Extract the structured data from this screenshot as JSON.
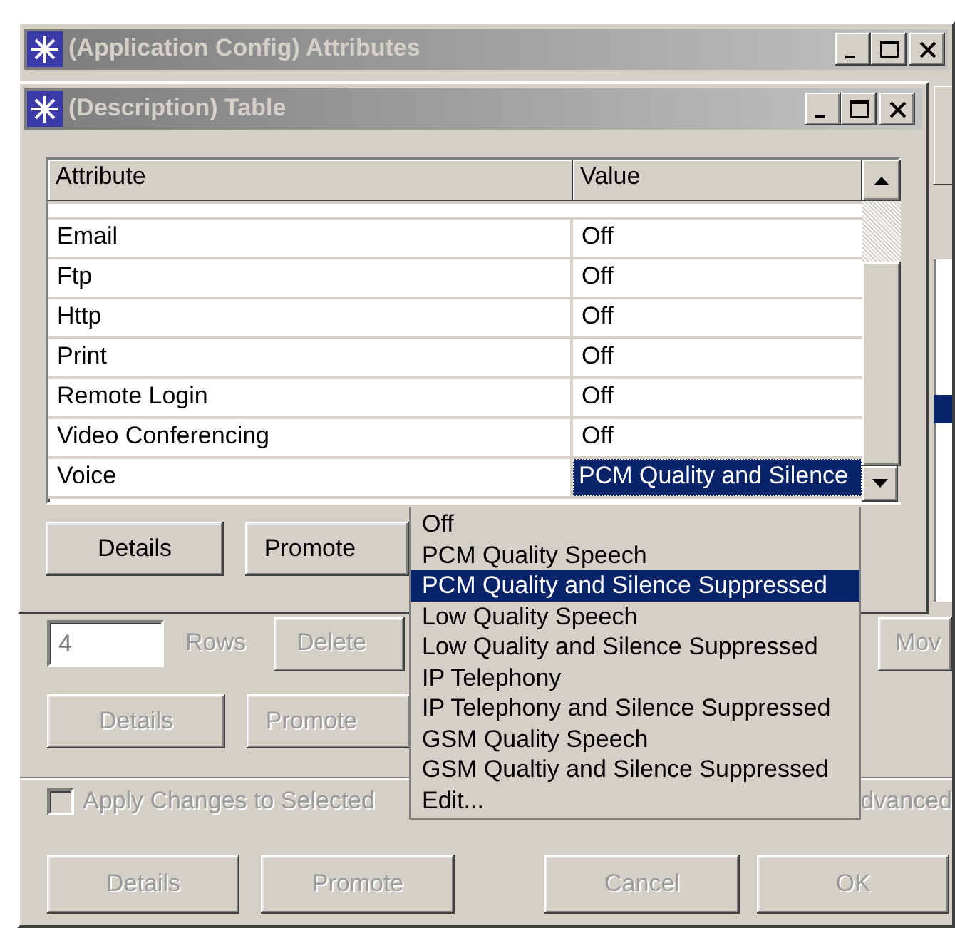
{
  "outer_window": {
    "title": "(Application Config) Attributes",
    "rows_field": {
      "value": "4",
      "disabled": true
    },
    "rows_label": "Rows",
    "row_buttons": [
      {
        "label": "Delete",
        "disabled": true
      },
      {
        "label": "Mov",
        "disabled": true
      }
    ],
    "second_buttons": [
      {
        "label": "Details",
        "disabled": true
      },
      {
        "label": "Promote",
        "disabled": true
      }
    ],
    "apply_checkbox": {
      "label": "Apply Changes to Selected",
      "checked": false,
      "disabled": true
    },
    "advanced_label": "dvanced",
    "footer_buttons": [
      {
        "label": "Details",
        "disabled": true
      },
      {
        "label": "Promote",
        "disabled": true
      },
      {
        "label": "Cancel",
        "disabled": true
      },
      {
        "label": "OK",
        "disabled": true
      }
    ]
  },
  "inner_window": {
    "title": "(Description) Table",
    "table": {
      "columns": [
        "Attribute",
        "Value"
      ],
      "rows": [
        {
          "attribute": "Email",
          "value": "Off",
          "selected": false
        },
        {
          "attribute": "Ftp",
          "value": "Off",
          "selected": false
        },
        {
          "attribute": "Http",
          "value": "Off",
          "selected": false
        },
        {
          "attribute": "Print",
          "value": "Off",
          "selected": false
        },
        {
          "attribute": "Remote Login",
          "value": "Off",
          "selected": false
        },
        {
          "attribute": "Video Conferencing",
          "value": "Off",
          "selected": false
        },
        {
          "attribute": "Voice",
          "value": "PCM Quality and Silence",
          "selected": true
        }
      ]
    },
    "buttons": [
      {
        "label": "Details",
        "disabled": false
      },
      {
        "label": "Promote",
        "disabled": false
      }
    ]
  },
  "dropdown": {
    "options": [
      {
        "label": "Off",
        "selected": false
      },
      {
        "label": "PCM Quality Speech",
        "selected": false
      },
      {
        "label": "PCM Quality and Silence Suppressed",
        "selected": true
      },
      {
        "label": "Low Quality Speech",
        "selected": false
      },
      {
        "label": "Low Quality and Silence Suppressed",
        "selected": false
      },
      {
        "label": "IP Telephony",
        "selected": false
      },
      {
        "label": "IP Telephony and Silence Suppressed",
        "selected": false
      },
      {
        "label": "GSM Quality Speech",
        "selected": false
      },
      {
        "label": "GSM Qualtiy and Silence Suppressed",
        "selected": false
      },
      {
        "label": "Edit...",
        "selected": false
      }
    ]
  }
}
